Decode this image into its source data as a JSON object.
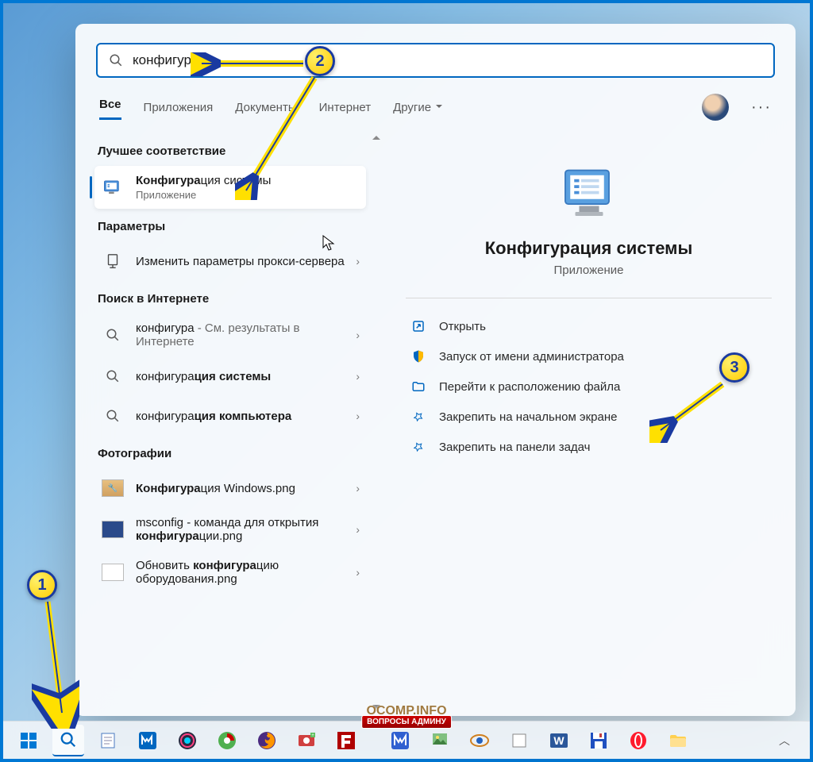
{
  "search": {
    "query": "конфигура"
  },
  "tabs": [
    "Все",
    "Приложения",
    "Документы",
    "Интернет",
    "Другие"
  ],
  "sections": {
    "best": {
      "label": "Лучшее соответствие"
    },
    "params": {
      "label": "Параметры"
    },
    "internet": {
      "label": "Поиск в Интернете"
    },
    "photos": {
      "label": "Фотографии"
    }
  },
  "results": {
    "best_item": {
      "title_pre": "Конфигура",
      "title_post": "ция системы",
      "sub": "Приложение"
    },
    "proxy": {
      "label": "Изменить параметры прокси-сервера"
    },
    "web1": {
      "pre": "конфигура",
      "post": " - См. результаты в Интернете"
    },
    "web2": {
      "pre": "конфигура",
      "bold": "ция системы"
    },
    "web3": {
      "pre": "конфигура",
      "bold": "ция компьютера"
    },
    "photo1": {
      "bold": "Конфигура",
      "post": "ция Windows.png"
    },
    "photo2": {
      "pre": "msconfig - команда для открытия ",
      "bold": "конфигура",
      "post": "ции.png"
    },
    "photo3": {
      "pre": "Обновить ",
      "bold": "конфигура",
      "post": "цию оборудования.png"
    }
  },
  "detail": {
    "title": "Конфигурация системы",
    "sub": "Приложение",
    "actions": [
      "Открыть",
      "Запуск от имени администратора",
      "Перейти к расположению файла",
      "Закрепить на начальном экране",
      "Закрепить на панели задач"
    ]
  },
  "callouts": {
    "c1": "1",
    "c2": "2",
    "c3": "3"
  },
  "watermark": {
    "top": "OCOMP.INFO",
    "bottom": "ВОПРОСЫ АДМИНУ"
  }
}
